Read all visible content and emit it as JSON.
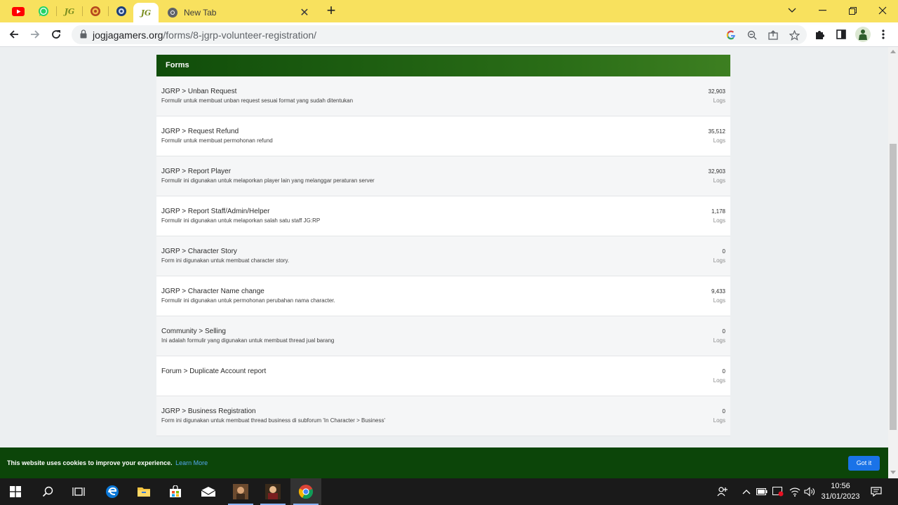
{
  "browser": {
    "tabs": [
      {
        "name": "youtube"
      },
      {
        "name": "whatsapp"
      },
      {
        "name": "jg",
        "text": "JG"
      },
      {
        "name": "site"
      },
      {
        "name": "site2"
      },
      {
        "name": "jg-active",
        "text": "JG"
      }
    ],
    "newtab_label": "New Tab",
    "url_domain": "jogjagamers.org",
    "url_path": "/forms/8-jgrp-volunteer-registration/"
  },
  "page": {
    "header": "Forms",
    "forms": [
      {
        "title": "JGRP > Unban Request",
        "desc": "Formulir untuk membuat unban request sesuai format yang sudah ditentukan",
        "count": "32,903",
        "unit": "Logs"
      },
      {
        "title": "JGRP > Request Refund",
        "desc": "Formulir untuk membuat permohonan refund",
        "count": "35,512",
        "unit": "Logs"
      },
      {
        "title": "JGRP > Report Player",
        "desc": "Formulir ini digunakan untuk melaporkan player lain yang melanggar peraturan server",
        "count": "32,903",
        "unit": "Logs"
      },
      {
        "title": "JGRP > Report Staff/Admin/Helper",
        "desc": "Formulir ini digunakan untuk melaporkan salah satu staff JG:RP",
        "count": "1,178",
        "unit": "Logs"
      },
      {
        "title": "JGRP > Character Story",
        "desc": "Form ini digunakan untuk membuat character story.",
        "count": "0",
        "unit": "Logs"
      },
      {
        "title": "JGRP > Character Name change",
        "desc": "Formulir ini digunakan untuk permohonan perubahan nama character.",
        "count": "9,433",
        "unit": "Logs"
      },
      {
        "title": "Community > Selling",
        "desc": "Ini adalah formulir yang digunakan untuk membuat thread jual barang",
        "count": "0",
        "unit": "Logs"
      },
      {
        "title": "Forum > Duplicate Account report",
        "desc": "",
        "count": "0",
        "unit": "Logs"
      },
      {
        "title": "JGRP > Business Registration",
        "desc": "Form ini digunakan untuk membuat thread business di subforum 'In Character > Business'",
        "count": "0",
        "unit": "Logs"
      }
    ]
  },
  "cookie": {
    "text": "This website uses cookies to improve your experience.",
    "link": "Learn More",
    "button": "Got it"
  },
  "taskbar": {
    "time": "10:56",
    "date": "31/01/2023"
  },
  "colors": {
    "tabstrip": "#f8e15e",
    "header_green": "#104d0a",
    "cookie_bar": "#0c4509",
    "accent_blue": "#1a73e8"
  }
}
